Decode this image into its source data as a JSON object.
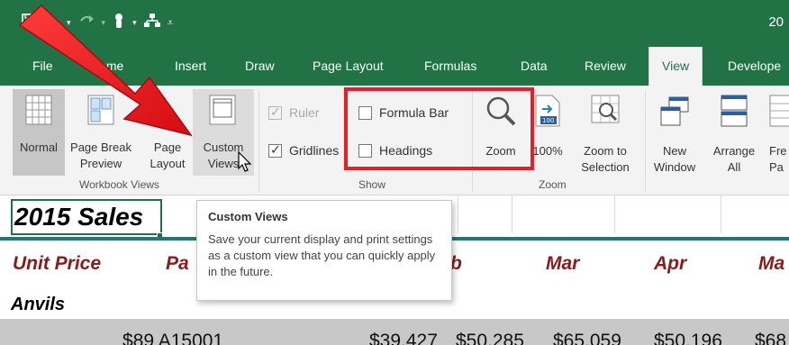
{
  "titlebar": {
    "right_text": "20"
  },
  "qat": {
    "save_icon": "save-icon",
    "undo_icon": "undo-icon",
    "redo_icon": "redo-icon",
    "more_icon": "customize-qat-icon"
  },
  "tabs": [
    {
      "label": "File"
    },
    {
      "label": "Home"
    },
    {
      "label": "Insert"
    },
    {
      "label": "Draw"
    },
    {
      "label": "Page Layout"
    },
    {
      "label": "Formulas"
    },
    {
      "label": "Data"
    },
    {
      "label": "Review"
    },
    {
      "label": "View",
      "active": true
    },
    {
      "label": "Develope"
    }
  ],
  "ribbon": {
    "workbook_views": {
      "group_label": "Workbook Views",
      "normal": "Normal",
      "page_break_1": "Page Break",
      "page_break_2": "Preview",
      "page_layout_1": "Page",
      "page_layout_2": "Layout",
      "custom_views_1": "Custom",
      "custom_views_2": "Views"
    },
    "show": {
      "group_label": "Show",
      "ruler": "Ruler",
      "ruler_checked": true,
      "gridlines": "Gridlines",
      "gridlines_checked": true,
      "formula_bar": "Formula Bar",
      "formula_bar_checked": false,
      "headings": "Headings",
      "headings_checked": false
    },
    "zoom": {
      "group_label": "Zoom",
      "zoom": "Zoom",
      "hundred": "100%",
      "zoom_to_1": "Zoom to",
      "zoom_to_2": "Selection"
    },
    "window": {
      "new_1": "New",
      "new_2": "Window",
      "arrange_1": "Arrange",
      "arrange_2": "All",
      "freeze_1": "Fre",
      "freeze_2": "Pa"
    }
  },
  "sheet": {
    "title": "2015 Sales",
    "headers": {
      "unit_price": "Unit Price",
      "part": "Pa",
      "feb": "b",
      "mar": "Mar",
      "apr": "Apr",
      "may": "Ma"
    },
    "row_label": "Anvils",
    "values": [
      "$89 A15001",
      "$39,427",
      "$50,285",
      "$65,059",
      "$50,196",
      "$68"
    ]
  },
  "tooltip": {
    "title": "Custom Views",
    "body": "Save your current display and print settings as a custom view that you can quickly apply in the future."
  },
  "colors": {
    "excel_green": "#217346",
    "annotation_red": "#e81e25",
    "header_red": "#8b1a1a"
  }
}
